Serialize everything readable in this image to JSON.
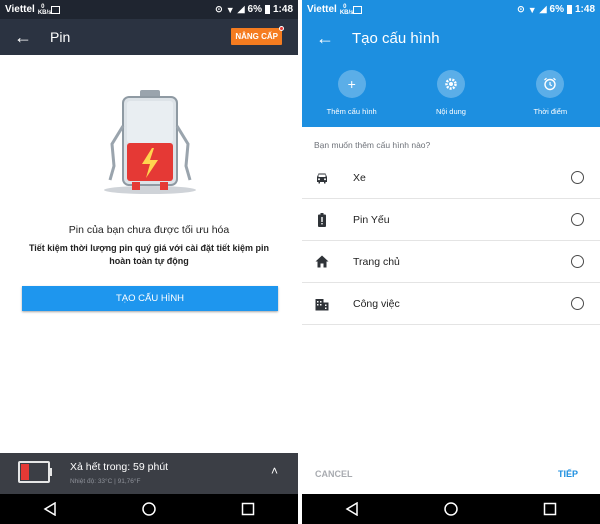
{
  "status_bar": {
    "carrier": "Viettel",
    "data_rate": "0\nKB/s",
    "battery_percent": "6%",
    "time": "1:48"
  },
  "left_screen": {
    "title": "Pin",
    "upgrade_label": "NÂNG CẤP",
    "message_title": "Pin của bạn chưa được tối ưu hóa",
    "message_body": "Tiết kiệm thời lượng pin quý giá với cài đặt tiết kiệm pin hoàn toàn tự động",
    "create_button": "TẠO CẤU HÌNH",
    "bottom_panel": {
      "title": "Xả hết trong: 59 phút",
      "subtitle": "Nhiệt độ: 33°C | 91,76°F"
    },
    "battery_level_fraction": 0.06
  },
  "right_screen": {
    "title": "Tạo cấu hình",
    "actions": [
      {
        "label": "Thêm cấu hình",
        "icon": "plus-icon"
      },
      {
        "label": "Nội dung",
        "icon": "gear-icon"
      },
      {
        "label": "Thời điểm",
        "icon": "alarm-clock-icon"
      }
    ],
    "question": "Bạn muốn thêm cấu hình nào?",
    "options": [
      {
        "label": "Xe",
        "icon": "car-icon"
      },
      {
        "label": "Pin Yếu",
        "icon": "low-battery-icon"
      },
      {
        "label": "Trang chủ",
        "icon": "home-icon"
      },
      {
        "label": "Công việc",
        "icon": "building-icon"
      }
    ],
    "cancel_label": "CANCEL",
    "next_label": "TIẾP"
  },
  "colors": {
    "left_statusbar": "#1f2530",
    "left_toolbar": "#2b3341",
    "accent_blue": "#1d8fe0",
    "button_blue": "#1e96ee",
    "upgrade_orange": "#f57c20",
    "battery_red": "#e53935",
    "bottom_panel": "#3b3e45"
  }
}
